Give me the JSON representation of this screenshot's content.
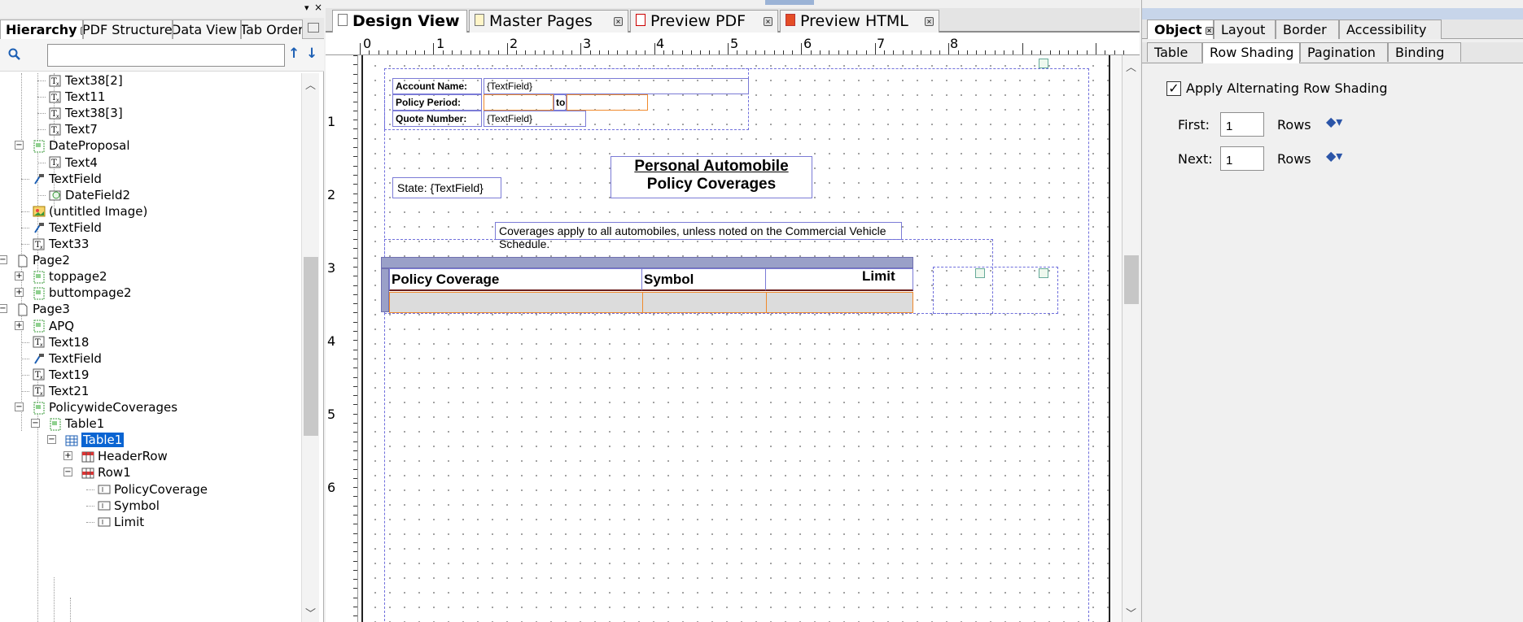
{
  "left_panel": {
    "tabs": [
      {
        "label": "Hierarchy",
        "active": true
      },
      {
        "label": "PDF Structure"
      },
      {
        "label": "Data View"
      },
      {
        "label": "Tab Order"
      }
    ],
    "search": {
      "value": ""
    },
    "tree": [
      {
        "label": "Text38[2]",
        "icon": "text-icon"
      },
      {
        "label": "Text11",
        "icon": "text-icon"
      },
      {
        "label": "Text38[3]",
        "icon": "text-icon"
      },
      {
        "label": "Text7",
        "icon": "text-icon"
      },
      {
        "label": "DateProposal",
        "icon": "subform-icon"
      },
      {
        "label": "Text4",
        "icon": "text-icon"
      },
      {
        "label": "TextField",
        "icon": "textfield-icon"
      },
      {
        "label": "DateField2",
        "icon": "datefield-icon"
      },
      {
        "label": "(untitled Image)",
        "icon": "image-icon"
      },
      {
        "label": "TextField",
        "icon": "textfield-icon"
      },
      {
        "label": "Text33",
        "icon": "text-icon"
      },
      {
        "label": "Page2",
        "icon": "page-icon"
      },
      {
        "label": "toppage2",
        "icon": "subform-icon"
      },
      {
        "label": "buttompage2",
        "icon": "subform-icon"
      },
      {
        "label": "Page3",
        "icon": "page-icon"
      },
      {
        "label": "APQ",
        "icon": "subform-icon"
      },
      {
        "label": "Text18",
        "icon": "text-icon"
      },
      {
        "label": "TextField",
        "icon": "textfield-icon"
      },
      {
        "label": "Text19",
        "icon": "text-icon"
      },
      {
        "label": "Text21",
        "icon": "text-icon"
      },
      {
        "label": "PolicywideCoverages",
        "icon": "subform-icon"
      },
      {
        "label": "Table1",
        "icon": "subform-icon"
      },
      {
        "label": "Table1",
        "icon": "table-icon",
        "selected": true
      },
      {
        "label": "HeaderRow",
        "icon": "header-row-icon"
      },
      {
        "label": "Row1",
        "icon": "row-icon"
      },
      {
        "label": "PolicyCoverage",
        "icon": "cell-icon"
      },
      {
        "label": "Symbol",
        "icon": "cell-icon"
      },
      {
        "label": "Limit",
        "icon": "cell-icon"
      }
    ]
  },
  "center": {
    "tabs": [
      {
        "label": "Design View",
        "active": true
      },
      {
        "label": "Master Pages"
      },
      {
        "label": "Preview PDF"
      },
      {
        "label": "Preview HTML"
      }
    ],
    "ruler_h": [
      "0",
      "1",
      "2",
      "3",
      "4",
      "5",
      "6",
      "7",
      "8"
    ],
    "ruler_v": [
      "1",
      "2",
      "3",
      "4",
      "5",
      "6"
    ],
    "form": {
      "account_name_label": "Account Name:",
      "account_name_value": "{TextField}",
      "policy_period_label": "Policy Period:",
      "policy_period_to": "to",
      "quote_number_label": "Quote Number:",
      "quote_number_value": "{TextField}",
      "title_line1": "Personal Automobile",
      "title_line2": "Policy Coverages",
      "state_text": "State: {TextField}",
      "coverages_note": "Coverages apply to all automobiles, unless noted on the Commercial Vehicle Schedule.",
      "table_headers": [
        "Policy Coverage",
        "Symbol",
        "Limit"
      ]
    }
  },
  "right_panel": {
    "tabs": [
      {
        "label": "Object",
        "active": true
      },
      {
        "label": "Layout"
      },
      {
        "label": "Border"
      },
      {
        "label": "Accessibility"
      }
    ],
    "subtabs": [
      {
        "label": "Table"
      },
      {
        "label": "Row Shading",
        "active": true
      },
      {
        "label": "Pagination"
      },
      {
        "label": "Binding"
      }
    ],
    "apply_shading_label": "Apply Alternating Row Shading",
    "apply_shading_checked": true,
    "first_label": "First:",
    "first_value": "1",
    "first_unit": "Rows",
    "next_label": "Next:",
    "next_value": "1",
    "next_unit": "Rows"
  }
}
